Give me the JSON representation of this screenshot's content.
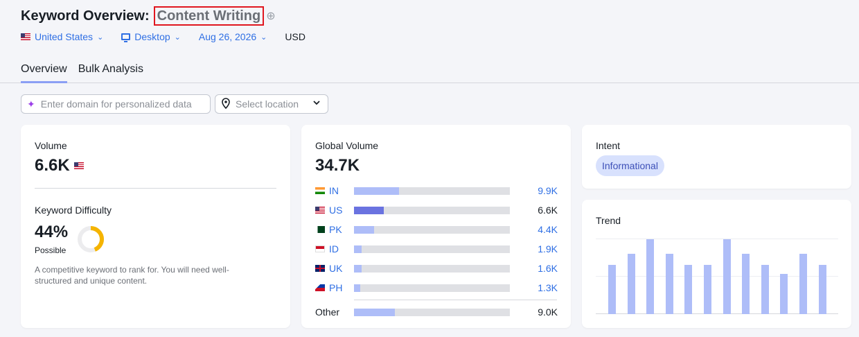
{
  "header": {
    "title": "Keyword Overview:",
    "keyword": "Content Writing"
  },
  "filters": {
    "country": "United States",
    "device": "Desktop",
    "date": "Aug 26, 2026",
    "currency": "USD"
  },
  "tabs": [
    {
      "label": "Overview",
      "active": true
    },
    {
      "label": "Bulk Analysis",
      "active": false
    }
  ],
  "domain_input": {
    "placeholder": "Enter domain for personalized data"
  },
  "location_select": {
    "placeholder": "Select location"
  },
  "volume": {
    "label": "Volume",
    "value": "6.6K"
  },
  "keyword_difficulty": {
    "label": "Keyword Difficulty",
    "value": "44%",
    "rating": "Possible",
    "percent": 44,
    "note": "A competitive keyword to rank for. You will need well-structured and unique content."
  },
  "global_volume": {
    "label": "Global Volume",
    "total": "34.7K",
    "rows": [
      {
        "code": "IN",
        "value": "9.9K",
        "fraction": 0.29,
        "highlight": false
      },
      {
        "code": "US",
        "value": "6.6K",
        "fraction": 0.19,
        "highlight": true
      },
      {
        "code": "PK",
        "value": "4.4K",
        "fraction": 0.13,
        "highlight": false
      },
      {
        "code": "ID",
        "value": "1.9K",
        "fraction": 0.05,
        "highlight": false
      },
      {
        "code": "UK",
        "value": "1.6K",
        "fraction": 0.05,
        "highlight": false
      },
      {
        "code": "PH",
        "value": "1.3K",
        "fraction": 0.04,
        "highlight": false
      }
    ],
    "other": {
      "label": "Other",
      "value": "9.0K",
      "fraction": 0.26
    }
  },
  "intent": {
    "label": "Intent",
    "value": "Informational"
  },
  "trend": {
    "label": "Trend",
    "values": [
      0.66,
      0.81,
      1.0,
      0.81,
      0.66,
      0.66,
      1.0,
      0.81,
      0.66,
      0.54,
      0.81,
      0.66
    ]
  },
  "colors": {
    "accent": "#2f6fe4",
    "bar": "#aebdf8",
    "bar_highlight": "#6a73e0",
    "kd": "#f5b400"
  }
}
